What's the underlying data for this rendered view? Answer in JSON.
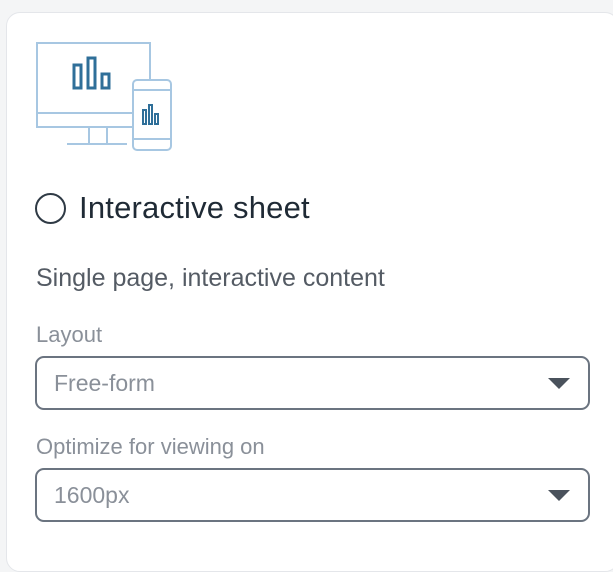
{
  "option": {
    "title": "Interactive sheet",
    "description": "Single page, interactive content",
    "selected": false,
    "illustration_icon": "desktop-and-mobile-chart-icon"
  },
  "layout": {
    "label": "Layout",
    "value": "Free-form"
  },
  "optimize": {
    "label": "Optimize for viewing on",
    "value": "1600px"
  },
  "colors": {
    "illustration_blue": "#a7c7e2",
    "bar_blue": "#2f6f99",
    "text_dark": "#1f2a35",
    "text_muted": "#8a9099",
    "border": "#6b7480"
  }
}
